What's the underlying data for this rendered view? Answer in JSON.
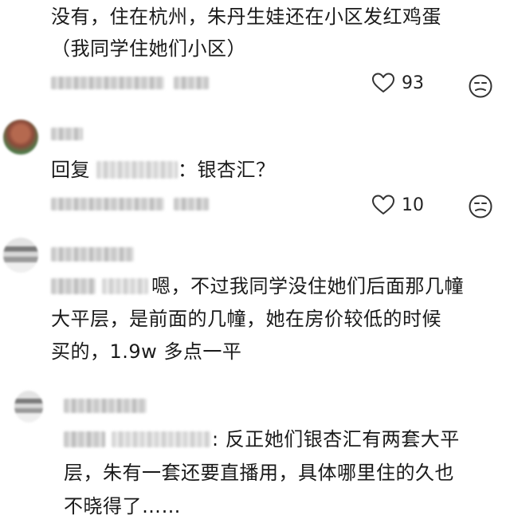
{
  "comment1": {
    "text_line1": "没有，住在杭州，朱丹生娃还在小区发红鸡蛋",
    "text_line2": "（我同学住她们小区）",
    "likes": "93"
  },
  "comment2": {
    "reply_prefix": "回复",
    "reply_suffix": "：银杏汇？",
    "likes": "10"
  },
  "comment3": {
    "text_line1": "嗯，不过我同学没住她们后面那几幢",
    "text_line2": "大平层，是前面的几幢，她在房价较低的时候",
    "text_line3": "买的，1.9w 多点一平"
  },
  "comment4": {
    "text_line1": ": 反正她们银杏汇有两套大平",
    "text_line2": "层，朱有一套还要直播用，具体哪里住的久也",
    "text_line3": "不晓得了……"
  },
  "icons": {
    "like": "heart-outline-icon",
    "react": "neutral-face-icon"
  }
}
